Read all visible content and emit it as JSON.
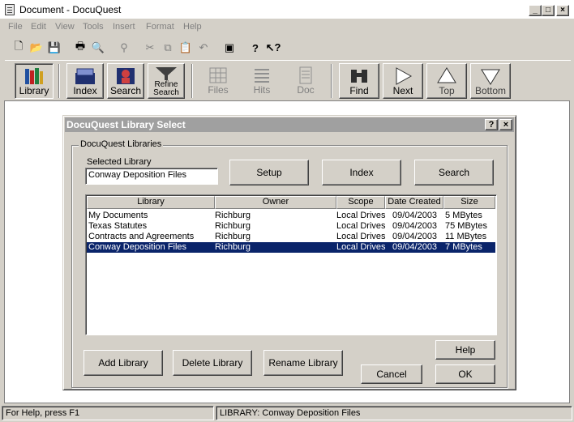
{
  "window": {
    "title": "Document - DocuQuest"
  },
  "menu": [
    "File",
    "Edit",
    "View",
    "Tools",
    "Insert",
    "Format",
    "Help"
  ],
  "big_toolbar": {
    "library": "Library",
    "index": "Index",
    "search": "Search",
    "refine_line1": "Refine",
    "refine_line2": "Search",
    "files": "Files",
    "hits": "Hits",
    "doc": "Doc",
    "find": "Find",
    "next": "Next",
    "top": "Top",
    "bottom": "Bottom"
  },
  "dialog": {
    "title": "DocuQuest Library Select",
    "group_label": "DocuQuest Libraries",
    "selected_label": "Selected Library",
    "selected_value": "Conway Deposition Files",
    "buttons": {
      "setup": "Setup",
      "index": "Index",
      "search": "Search",
      "add": "Add Library",
      "delete": "Delete Library",
      "rename": "Rename Library",
      "help": "Help",
      "cancel": "Cancel",
      "ok": "OK"
    },
    "columns": [
      "Library",
      "Owner",
      "Scope",
      "Date Created",
      "Size"
    ],
    "rows": [
      {
        "library": "My Documents",
        "owner": "Richburg",
        "scope": "Local Drives",
        "date": "09/04/2003",
        "size": "5 MBytes"
      },
      {
        "library": "Texas Statutes",
        "owner": "Richburg",
        "scope": "Local Drives",
        "date": "09/04/2003",
        "size": "75 MBytes"
      },
      {
        "library": "Contracts and Agreements",
        "owner": "Richburg",
        "scope": "Local Drives",
        "date": "09/04/2003",
        "size": "11 MBytes"
      },
      {
        "library": "Conway Deposition Files",
        "owner": "Richburg",
        "scope": "Local Drives",
        "date": "09/04/2003",
        "size": "7 MBytes"
      }
    ],
    "selected_row": 3
  },
  "status": {
    "help": "For Help, press F1",
    "library": "LIBRARY:  Conway Deposition Files"
  },
  "colors": {
    "selection": "#0a246a",
    "face": "#d4d0c8",
    "inactive_title": "#a0a0a0"
  }
}
